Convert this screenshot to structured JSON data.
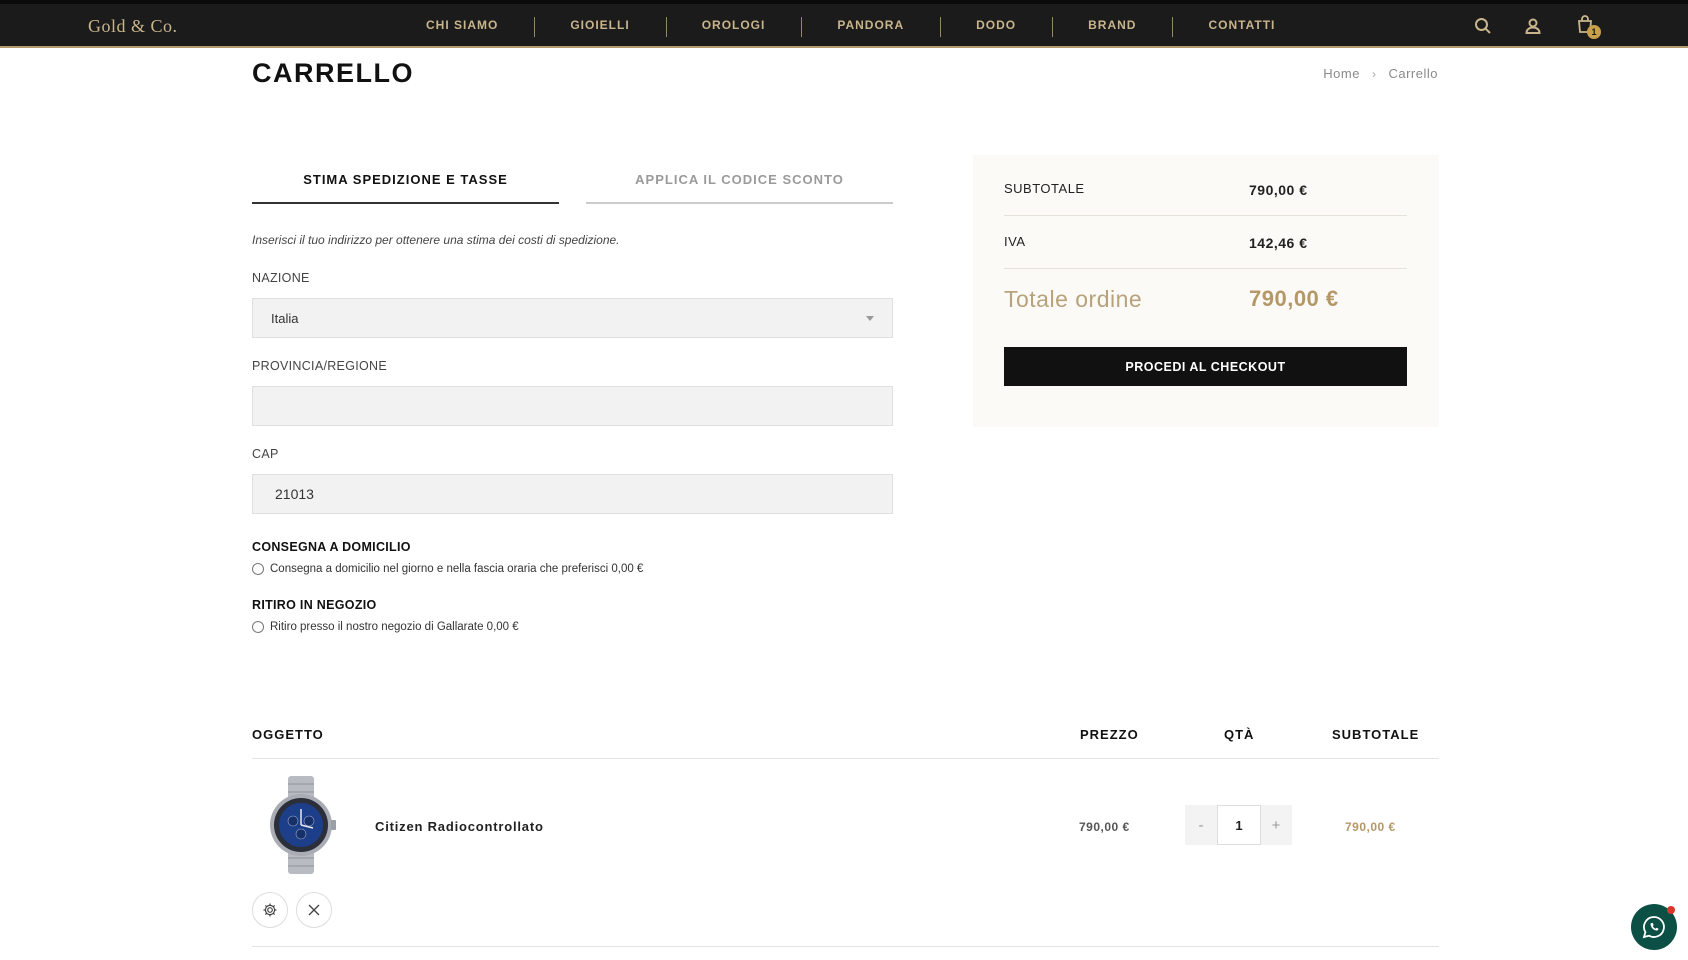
{
  "header": {
    "logo": "Gold & Co.",
    "nav": [
      "CHI SIAMO",
      "GIOIELLI",
      "OROLOGI",
      "PANDORA",
      "DODO",
      "BRAND",
      "CONTATTI"
    ],
    "cart_count": "1",
    "icons": [
      "search-icon",
      "user-icon",
      "cart-icon"
    ]
  },
  "page": {
    "title": "CARRELLO",
    "breadcrumb": [
      "Home",
      "Carrello"
    ]
  },
  "tabs": [
    "STIMA SPEDIZIONE E TASSE",
    "APPLICA IL CODICE SCONTO"
  ],
  "shipping": {
    "hint": "Inserisci il tuo indirizzo per ottenere una stima dei costi di spedizione.",
    "country_label": "NAZIONE",
    "country_value": "Italia",
    "region_label": "PROVINCIA/REGIONE",
    "region_value": "",
    "zip_label": "CAP",
    "zip_value": "21013",
    "home_delivery_title": "CONSEGNA A DOMICILIO",
    "home_delivery_option": "Consegna a domicilio nel giorno e nella fascia oraria che preferisci 0,00 €",
    "pickup_title": "RITIRO IN NEGOZIO",
    "pickup_option": "Ritiro presso il nostro negozio di Gallarate 0,00 €"
  },
  "summary": {
    "subtotal_label": "SUBTOTALE",
    "subtotal_value": "790,00 €",
    "tax_label": "IVA",
    "tax_value": "142,46 €",
    "total_label": "Totale ordine",
    "total_value": "790,00 €",
    "checkout_label": "PROCEDI AL CHECKOUT"
  },
  "table": {
    "headers": [
      "OGGETTO",
      "PREZZO",
      "QTÀ",
      "SUBTOTALE"
    ],
    "items": [
      {
        "name": "Citizen Radiocontrollato",
        "price": "790,00 €",
        "qty": "1",
        "subtotal": "790,00 €",
        "minus": "-",
        "plus": "+"
      }
    ]
  },
  "colors": {
    "header_bg": "#1b1b1b",
    "gold": "#c9b58c",
    "accent": "#b49868",
    "summary_bg": "#fbfaf7"
  }
}
